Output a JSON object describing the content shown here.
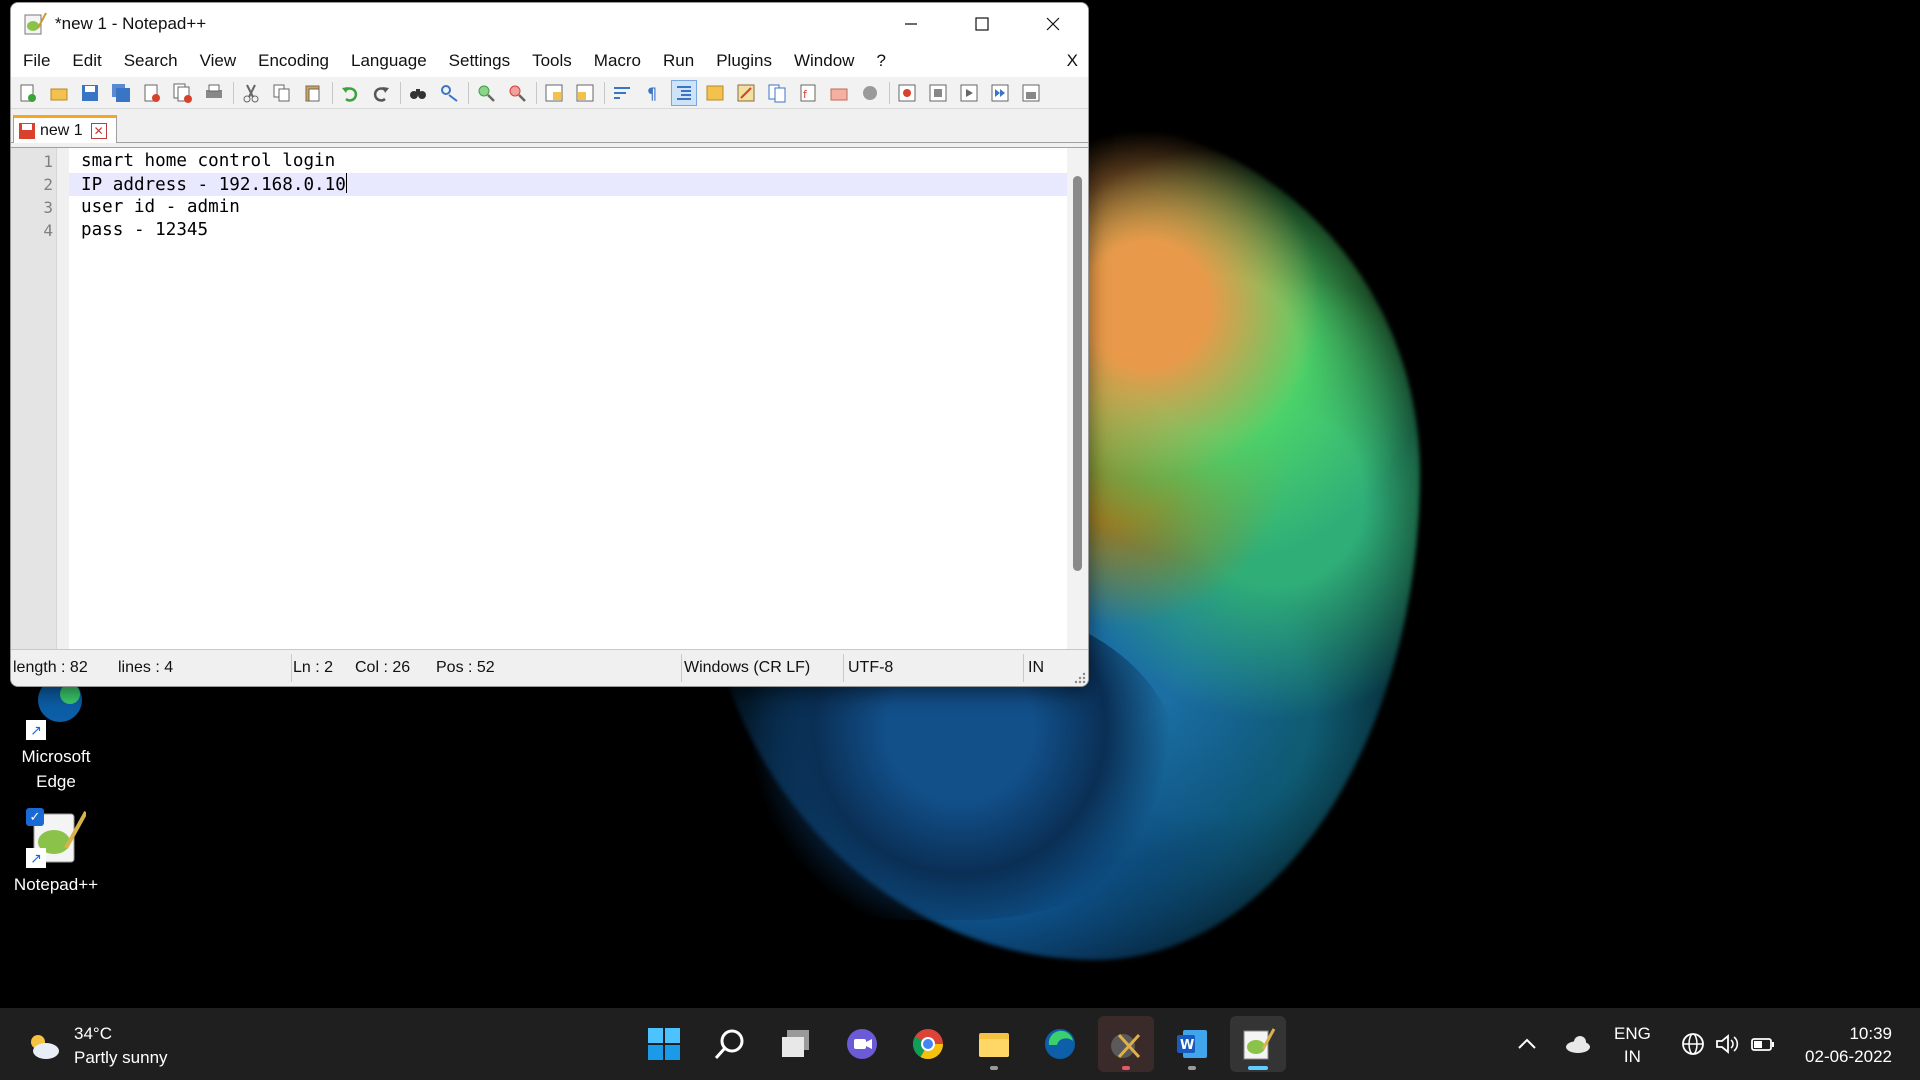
{
  "window": {
    "title": "*new 1 - Notepad++",
    "menu": [
      "File",
      "Edit",
      "Search",
      "View",
      "Encoding",
      "Language",
      "Settings",
      "Tools",
      "Macro",
      "Run",
      "Plugins",
      "Window",
      "?"
    ],
    "menu_close": "X",
    "tab_label": "new 1",
    "line_numbers": [
      "1",
      "2",
      "3",
      "4"
    ],
    "lines": [
      "smart home control login",
      "IP address - 192.168.0.10",
      "user id - admin",
      "pass - 12345"
    ],
    "current_line": 2
  },
  "statusbar": {
    "length": "length : 82",
    "lines": "lines : 4",
    "ln": "Ln : 2",
    "col": "Col : 26",
    "pos": "Pos : 52",
    "eol": "Windows (CR LF)",
    "encoding": "UTF-8",
    "mode": "IN"
  },
  "desktop": {
    "icons": [
      {
        "label_line1": "Microsoft",
        "label_line2": "Edge"
      },
      {
        "label_line1": "Notepad++",
        "label_line2": ""
      }
    ]
  },
  "taskbar": {
    "weather_temp": "34°C",
    "weather_desc": "Partly sunny",
    "lang_line1": "ENG",
    "lang_line2": "IN",
    "time": "10:39",
    "date": "02-06-2022"
  },
  "colors": {
    "taskbar": "#1f1f1f",
    "current_line": "#e8e8ff",
    "tab_accent": "#f5a623",
    "win_accent": "#60cdff"
  }
}
